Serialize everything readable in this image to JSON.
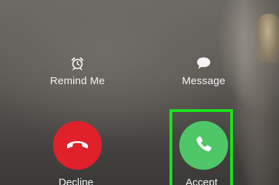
{
  "quick_actions": {
    "remind": {
      "label": "Remind Me",
      "icon": "alarm-clock-icon"
    },
    "message": {
      "label": "Message",
      "icon": "speech-bubble-icon"
    }
  },
  "call_actions": {
    "decline": {
      "label": "Decline",
      "icon": "hang-up-phone-icon",
      "color": "#e0202a"
    },
    "accept": {
      "label": "Accept",
      "icon": "phone-handset-icon",
      "color": "#4fc768"
    }
  },
  "highlight": {
    "target": "accept",
    "color": "#19e51b"
  }
}
